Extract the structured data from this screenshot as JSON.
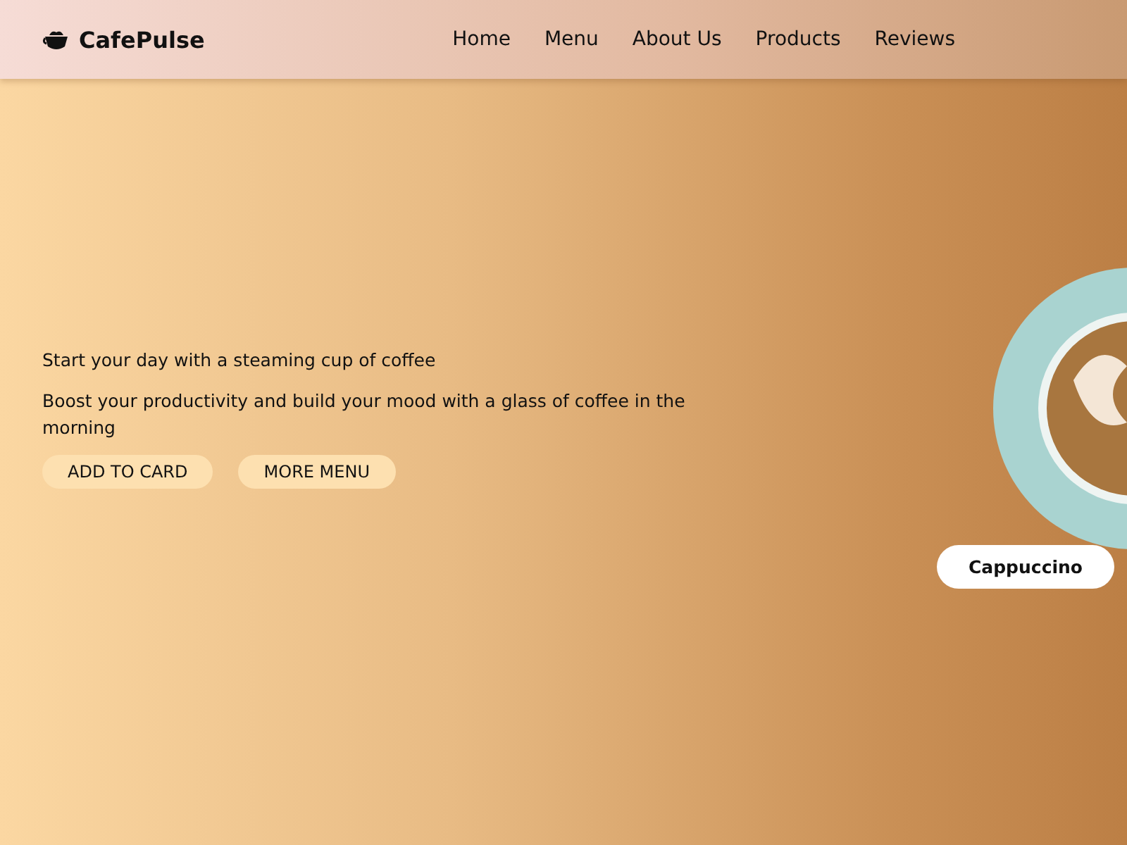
{
  "header": {
    "brand": "CafePulse",
    "nav": [
      {
        "label": "Home"
      },
      {
        "label": "Menu"
      },
      {
        "label": "About Us"
      },
      {
        "label": "Products"
      },
      {
        "label": "Reviews"
      }
    ]
  },
  "hero": {
    "tagline": "Start your day with a steaming cup of coffee",
    "description": "Boost your productivity and build your mood with a glass of coffee in the morning",
    "buttons": [
      {
        "label": "ADD TO CARD"
      },
      {
        "label": "MORE MENU"
      }
    ],
    "product_label": "Cappuccino"
  }
}
